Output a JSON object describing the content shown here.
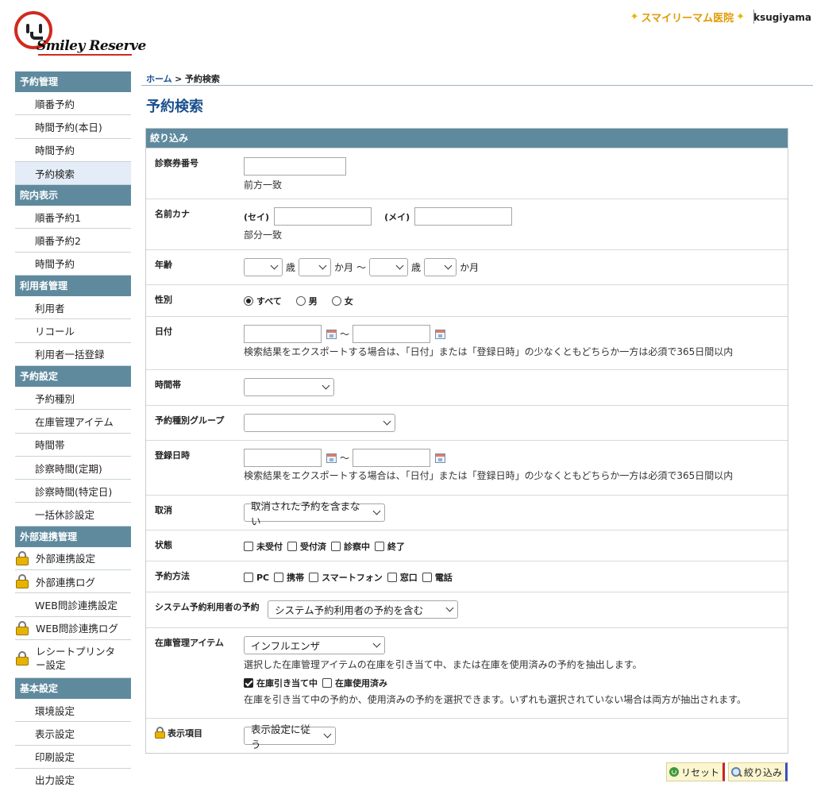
{
  "header": {
    "logo_text": "Smiley Reserve",
    "clinic_name": "スマイリーマム医院",
    "username": "ksugiyama"
  },
  "sidebar": {
    "sections": [
      {
        "title": "予約管理",
        "items": [
          "順番予約",
          "時間予約(本日)",
          "時間予約",
          "予約検索"
        ]
      },
      {
        "title": "院内表示",
        "items": [
          "順番予約1",
          "順番予約2",
          "時間予約"
        ]
      },
      {
        "title": "利用者管理",
        "items": [
          "利用者",
          "リコール",
          "利用者一括登録"
        ]
      },
      {
        "title": "予約設定",
        "items": [
          "予約種別",
          "在庫管理アイテム",
          "時間帯",
          "診察時間(定期)",
          "診察時間(特定日)",
          "一括休診設定"
        ]
      },
      {
        "title": "外部連携管理",
        "items": [
          "外部連携設定",
          "外部連携ログ",
          "WEB問診連携設定",
          "WEB問診連携ログ",
          "レシートプリンター設定"
        ]
      },
      {
        "title": "基本設定",
        "items": [
          "環境設定",
          "表示設定",
          "印刷設定",
          "出力設定"
        ]
      }
    ]
  },
  "breadcrumb": {
    "home": "ホーム",
    "sep": ">",
    "current": "予約検索"
  },
  "page_title": "予約検索",
  "filter": {
    "heading": "絞り込み",
    "ticket": {
      "label": "診察券番号",
      "hint": "前方一致",
      "value": ""
    },
    "kana": {
      "label": "名前カナ",
      "sei_label": "(セイ)",
      "mei_label": "(メイ)",
      "hint": "部分一致"
    },
    "age": {
      "label": "年齢",
      "unit_year": "歳",
      "unit_month": "か月",
      "range_sep": "〜"
    },
    "gender": {
      "label": "性別",
      "options": [
        "すべて",
        "男",
        "女"
      ],
      "selected": "すべて"
    },
    "date": {
      "label": "日付",
      "range_sep": "〜",
      "hint": "検索結果をエクスポートする場合は、「日付」または「登録日時」の少なくともどちらか一方は必須で365日間以内"
    },
    "timeslot": {
      "label": "時間帯",
      "value": ""
    },
    "group": {
      "label": "予約種別グループ",
      "value": ""
    },
    "registered": {
      "label": "登録日時",
      "range_sep": "〜",
      "hint": "検索結果をエクスポートする場合は、「日付」または「登録日時」の少なくともどちらか一方は必須で365日間以内"
    },
    "cancel": {
      "label": "取消",
      "value": "取消された予約を含まない"
    },
    "status": {
      "label": "状態",
      "options": [
        "未受付",
        "受付済",
        "診察中",
        "終了"
      ]
    },
    "method": {
      "label": "予約方法",
      "options": [
        "PC",
        "携帯",
        "スマートフォン",
        "窓口",
        "電話"
      ]
    },
    "system_user": {
      "label": "システム予約利用者の予約",
      "value": "システム予約利用者の予約を含む"
    },
    "stock": {
      "label": "在庫管理アイテム",
      "value": "インフルエンザ",
      "hint1": "選択した在庫管理アイテムの在庫を引き当て中、または在庫を使用済みの予約を抽出します。",
      "allocated": "在庫引き当て中",
      "used": "在庫使用済み",
      "hint2": "在庫を引き当て中の予約か、使用済みの予約を選択できます。いずれも選択されていない場合は両方が抽出されます。"
    },
    "display": {
      "label": "表示項目",
      "value": "表示設定に従う"
    }
  },
  "buttons": {
    "reset": "リセット",
    "search": "絞り込み"
  },
  "colors": {
    "accent": "#5f8a9e",
    "title": "#1a4f8e",
    "clinic": "#e09a00",
    "logo": "#d02a1d"
  }
}
